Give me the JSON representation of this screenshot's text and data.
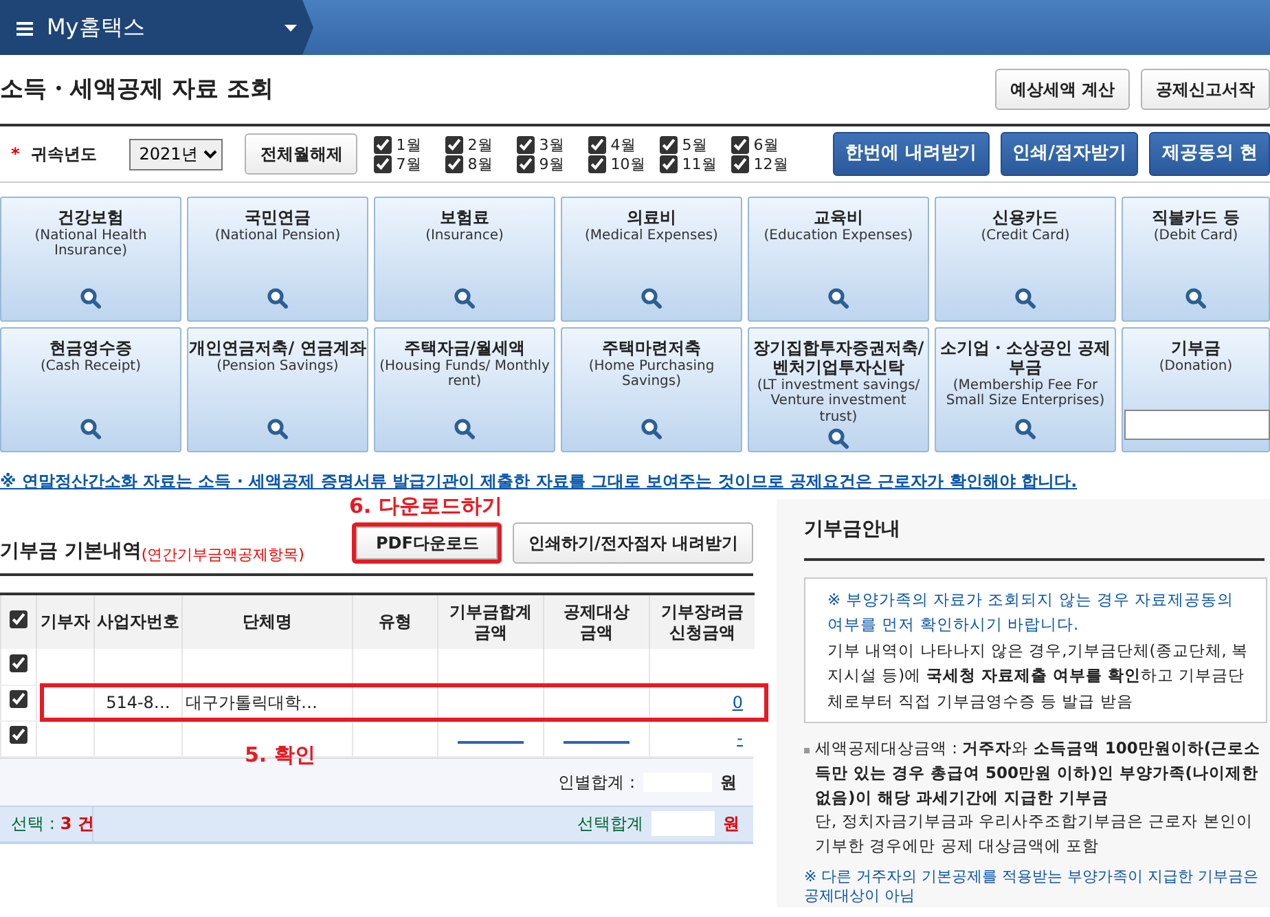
{
  "header": {
    "menu_title": "My홈택스"
  },
  "page_title": "소득・세액공제 자료 조회",
  "top_buttons": [
    "예상세액 계산",
    "공제신고서작"
  ],
  "filter": {
    "required_mark": "*",
    "label": "귀속년도",
    "year": "2021년",
    "clear_button": "전체월해제",
    "months": [
      {
        "label": "1월",
        "checked": true
      },
      {
        "label": "2월",
        "checked": true
      },
      {
        "label": "3월",
        "checked": true
      },
      {
        "label": "4월",
        "checked": true
      },
      {
        "label": "5월",
        "checked": true
      },
      {
        "label": "6월",
        "checked": true
      },
      {
        "label": "7월",
        "checked": true
      },
      {
        "label": "8월",
        "checked": true
      },
      {
        "label": "9월",
        "checked": true
      },
      {
        "label": "10월",
        "checked": true
      },
      {
        "label": "11월",
        "checked": true
      },
      {
        "label": "12월",
        "checked": true
      }
    ],
    "buttons": [
      "한번에 내려받기",
      "인쇄/점자받기",
      "제공동의 현"
    ]
  },
  "tiles": [
    {
      "title": "건강보험",
      "subtitle": "(National Health Insurance)",
      "kind": "search"
    },
    {
      "title": "국민연금",
      "subtitle": "(National Pension)",
      "kind": "search"
    },
    {
      "title": "보험료",
      "subtitle": "(Insurance)",
      "kind": "search"
    },
    {
      "title": "의료비",
      "subtitle": "(Medical Expenses)",
      "kind": "search"
    },
    {
      "title": "교육비",
      "subtitle": "(Education Expenses)",
      "kind": "search"
    },
    {
      "title": "신용카드",
      "subtitle": "(Credit Card)",
      "kind": "search"
    },
    {
      "title": "직불카드 등",
      "subtitle": "(Debit Card)",
      "kind": "search"
    },
    {
      "title": "현금영수증",
      "subtitle": "(Cash Receipt)",
      "kind": "search"
    },
    {
      "title": "개인연금저축/ 연금계좌",
      "subtitle": "(Pension Savings)",
      "kind": "search"
    },
    {
      "title": "주택자금/월세액",
      "subtitle": "(Housing Funds/ Monthly rent)",
      "kind": "search"
    },
    {
      "title": "주택마련저축",
      "subtitle": "(Home Purchasing Savings)",
      "kind": "search"
    },
    {
      "title": "장기집합투자증권저축/ 벤처기업투자신탁",
      "subtitle": "(LT investment savings/ Venture investment trust)",
      "kind": "search"
    },
    {
      "title": "소기업・소상공인 공제부금",
      "subtitle": "(Membership Fee For Small Size Enterprises)",
      "kind": "search"
    },
    {
      "title": "기부금",
      "subtitle": "(Donation)",
      "kind": "input"
    }
  ],
  "notice": "※ 연말정산간소화 자료는 소득 · 세액공제 증명서류 발급기관이 제출한 자료를 그대로 보여주는 것이므로 공제요건은 근로자가 확인해야 합니다.",
  "donation": {
    "title": "기부금 기본내역",
    "subtitle": "(연간기부금액공제항목)",
    "annotation_top": "6. 다운로드하기",
    "buttons": [
      {
        "label": "PDF다운로드",
        "highlighted": true
      },
      {
        "label": "인쇄하기/전자점자 내려받기",
        "highlighted": false
      }
    ],
    "header_checked": true,
    "columns": [
      "기부자",
      "사업자번호",
      "단체명",
      "유형",
      "기부금합계 금액",
      "공제대상 금액",
      "기부장려금 신청금액"
    ],
    "rows": [
      {
        "checked": true,
        "highlighted": false,
        "cells": [
          {},
          {},
          {},
          {},
          {},
          {},
          {}
        ]
      },
      {
        "checked": true,
        "highlighted": true,
        "cells": [
          {},
          {
            "text": "514-8…"
          },
          {
            "text": "대구가톨릭대학…"
          },
          {},
          {},
          {},
          {
            "text": "0",
            "link": true
          }
        ]
      },
      {
        "checked": true,
        "highlighted": false,
        "cells": [
          {},
          {},
          {},
          {},
          {
            "link": true
          },
          {
            "link": true
          },
          {
            "text": "-",
            "link": true
          }
        ]
      }
    ],
    "annotation": "5. 확인",
    "person_total_label": "인별합계 :",
    "person_total_unit": "원",
    "selection_label": "선택 :",
    "selection_count": "3 건",
    "selection_total_label": "선택합계",
    "selection_unit": "원"
  },
  "guide": {
    "title": "기부금안내",
    "box_note": "※ 부양가족의 자료가 조회되지 않는 경우 자료제공동의 여부를 먼저 확인하시기 바랍니다.",
    "box_text": "기부 내역이 나타나지 않은 경우,기부금단체(종교단체, 복지시설 등)에 **국세청 자료제출 여부를 확인**하고 기부금단체로부터 직접 기부금영수증 등 발급 받음",
    "bullet": "세액공제대상금액 : **거주자**와 **소득금액 100만원이하(근로소득만 있는 경우 총급여 500만원 이하)인 부양가족(나이제한 없음)이 해당 과세기간에 지급한 기부금**",
    "bullet_note": "단, 정치자금기부금과 우리사주조합기부금은 근로자 본인이 기부한 경우에만 공제 대상금액에 포함",
    "footer_note": "※ 다른 거주자의 기본공제를 적용받는 부양가족이 지급한 기부금은 공제대상이 아님"
  }
}
